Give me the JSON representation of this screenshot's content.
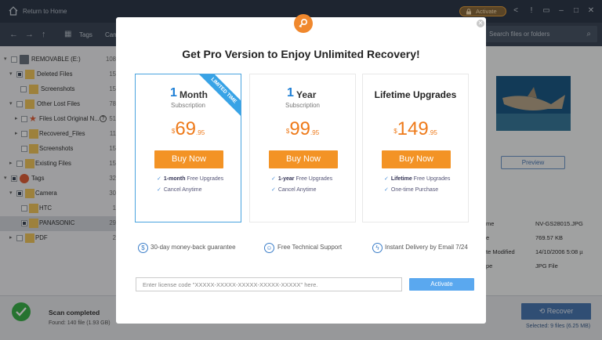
{
  "titlebar": {
    "title": "Return to Home",
    "activate_label": "Activate",
    "icons": [
      "home-icon",
      "lock-icon",
      "share-icon",
      "info-icon",
      "menu-icon",
      "minimize-icon",
      "maximize-icon",
      "close-icon"
    ]
  },
  "navbar": {
    "breadcrumb_tags": "Tags",
    "breadcrumb_camera": "Cam",
    "search_placeholder": "Search files or folders"
  },
  "sidebar": {
    "items": [
      {
        "label": "REMOVABLE (E:)",
        "count": "108"
      },
      {
        "label": "Deleted Files",
        "count": "15"
      },
      {
        "label": "Screenshots",
        "count": "15"
      },
      {
        "label": "Other Lost Files",
        "count": "78"
      },
      {
        "label": "Files Lost Original N...",
        "count": "51"
      },
      {
        "label": "Recovered_Files",
        "count": "11"
      },
      {
        "label": "Screenshots",
        "count": "15"
      },
      {
        "label": "Existing Files",
        "count": "15"
      },
      {
        "label": "Tags",
        "count": "32"
      },
      {
        "label": "Camera",
        "count": "30"
      },
      {
        "label": "HTC",
        "count": "1"
      },
      {
        "label": "PANASONIC",
        "count": "29"
      },
      {
        "label": "PDF",
        "count": "2"
      }
    ]
  },
  "preview": {
    "button_label": "Preview",
    "properties": [
      {
        "key": "me",
        "value": "NV-GS28015.JPG"
      },
      {
        "key": "e",
        "value": "769.57 KB"
      },
      {
        "key": "te Modified",
        "value": "14/10/2006 5:08 µ"
      },
      {
        "key": "pe",
        "value": "JPG File"
      }
    ]
  },
  "bottom": {
    "scan_title": "Scan completed",
    "scan_found": "Found: 140 file (1.93 GB)",
    "recover_label": "Recover",
    "selected_text": "Selected: 9 files (6.25 MB)"
  },
  "modal": {
    "title": "Get Pro Version to Enjoy Unlimited Recovery!",
    "plans": [
      {
        "num": "1",
        "unit": "Month",
        "subtitle": "Subscription",
        "currency": "$",
        "price": "69",
        "cents": ".95",
        "button": "Buy Now",
        "ribbon": "LIMITED TIME",
        "features": [
          {
            "bold": "1-month",
            "text": " Free Upgrades"
          },
          {
            "bold": "",
            "text": "Cancel Anytime"
          }
        ]
      },
      {
        "num": "1",
        "unit": "Year",
        "subtitle": "Subscription",
        "currency": "$",
        "price": "99",
        "cents": ".95",
        "button": "Buy Now",
        "features": [
          {
            "bold": "1-year",
            "text": " Free Upgrades"
          },
          {
            "bold": "",
            "text": "Cancel Anytime"
          }
        ]
      },
      {
        "title": "Lifetime Upgrades",
        "currency": "$",
        "price": "149",
        "cents": ".95",
        "button": "Buy Now",
        "features": [
          {
            "bold": "Lifetime",
            "text": " Free Upgrades"
          },
          {
            "bold": "",
            "text": "One-time Purchase"
          }
        ]
      }
    ],
    "guarantees": [
      "30-day money-back guarantee",
      "Free Technical Support",
      "Instant Delivery by Email 7/24"
    ],
    "license_placeholder": "Enter license code \"XXXXX-XXXXX-XXXXX-XXXXX-XXXXX\" here.",
    "activate_label": "Activate"
  },
  "colors": {
    "accent_orange": "#f39325",
    "accent_blue": "#1e7fd6",
    "titlebar": "#2f3a4a",
    "recover_blue": "#4a78b3",
    "success_green": "#3bb14a"
  }
}
